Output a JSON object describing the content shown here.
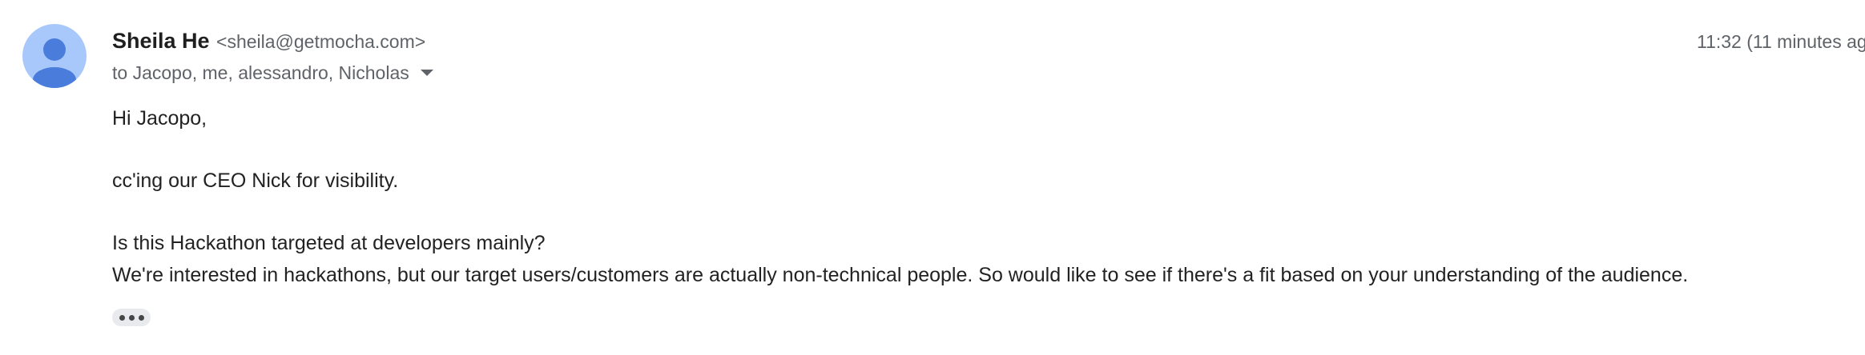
{
  "sender": {
    "name": "Sheila He",
    "email": "<sheila@getmocha.com>"
  },
  "recipients_line": "to Jacopo, me, alessandro, Nicholas",
  "timestamp": "11:32 (11 minutes ag",
  "body": {
    "line1": "Hi Jacopo,",
    "line2": "cc'ing our CEO Nick for visibility.",
    "line3": "Is this Hackathon targeted at developers mainly?",
    "line4": "We're interested in hackathons, but our target users/customers are actually non-technical people. So would like to see if there's a fit based on your understanding of the audience."
  },
  "colors": {
    "avatar_bg": "#a8c7fa",
    "avatar_fg": "#4a7cdc",
    "secondary_text": "#5f6368"
  },
  "icons": {
    "avatar": "default-person-avatar-icon",
    "recipients_toggle": "caret-down-icon",
    "trimmed_content": "more-horizontal-icon"
  }
}
